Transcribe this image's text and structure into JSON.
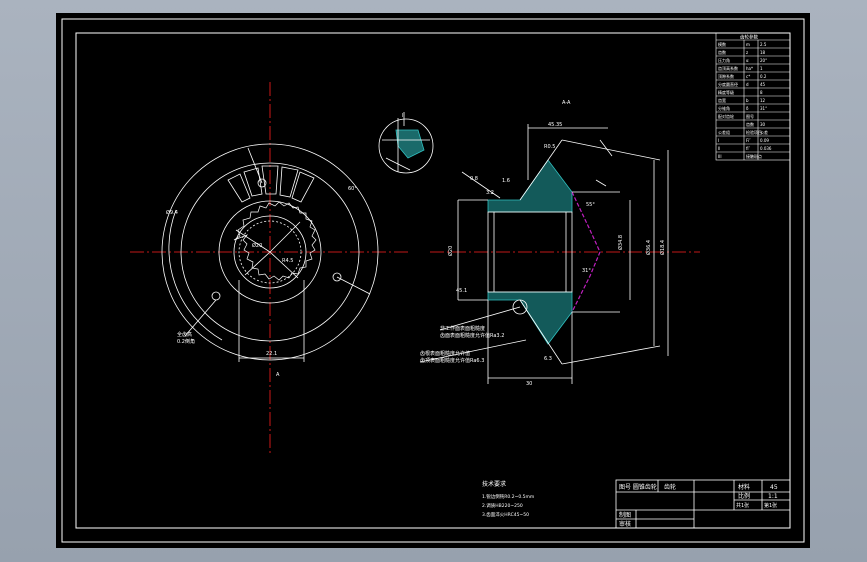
{
  "colors": {
    "background": "#000000",
    "line": "#ffffff",
    "centerline": "#ff2020",
    "hatch": "#30c0c0",
    "dimension": "#ffffff",
    "tooth_profile": "#c020c0",
    "outer_frame": "#9aa4b1"
  },
  "views": {
    "section_label": "A-A",
    "left_view_label": "A",
    "detail_labels": [
      "I",
      "II"
    ]
  },
  "dimensions": {
    "left_bottom": "22.1",
    "left_inner": "Ø20",
    "left_spline": "R4.5",
    "right_top": "45.35",
    "right_bottom": "30",
    "right_left_bottom": "45.1",
    "right_rt_1": "Ø34.8",
    "right_rt_2": "Ø36.4",
    "angle_1": "60°",
    "angle_2": "55°",
    "angle_3": "31°",
    "small_1": "0.8",
    "small_2": "3.2",
    "small_3": "1.6",
    "small_4": "R0.5",
    "small_5": "6.3",
    "small_6": "Ø9.4",
    "small_7": "Ø18.4"
  },
  "notes": {
    "left_note_1": "全齿高",
    "left_note_2": "0.2倒角",
    "leader_note_1": "非工作面表面粗糙度",
    "leader_note_2": "齿面表面粗糙度允许值Ra3.2",
    "leader_note_3": "齿根表面粗糙度允许值",
    "leader_note_4": "齿顶表面粗糙度允许值Ra6.3"
  },
  "tech_requirements": {
    "title": "技术要求",
    "lines": [
      "1.锐边倒钝R0.2~0.5mm",
      "2.调质HB220~250",
      "3.齿面淬火HRC45~50"
    ]
  },
  "title_block": {
    "drawing_name": "图号 圆锥齿轮",
    "part_type": "齿轮",
    "material_label": "材料",
    "material_value": "45",
    "scale_label": "比例",
    "scale_value": "1:1",
    "quantity_label": "共1张",
    "sheet_label": "第1张",
    "drawn_label": "制图",
    "checked_label": "审核"
  },
  "param_table": {
    "title": "齿轮参数",
    "rows": [
      [
        "模数",
        "m",
        "2.5"
      ],
      [
        "齿数",
        "z",
        "18"
      ],
      [
        "压力角",
        "α",
        "20°"
      ],
      [
        "齿顶高系数",
        "ha*",
        "1"
      ],
      [
        "顶隙系数",
        "c*",
        "0.2"
      ],
      [
        "分度圆直径",
        "d",
        "45"
      ],
      [
        "精度等级",
        "",
        "8"
      ],
      [
        "齿宽",
        "b",
        "12"
      ],
      [
        "分锥角",
        "δ",
        "31°"
      ],
      [
        "配对齿轮",
        "图号",
        ""
      ],
      [
        "",
        "齿数",
        "30"
      ],
      [
        "公差组",
        "检验项目",
        "公差"
      ],
      [
        "I",
        "Fi″",
        "0.09"
      ],
      [
        "II",
        "fi″",
        "0.036"
      ],
      [
        "III",
        "接触斑点",
        ""
      ]
    ]
  }
}
